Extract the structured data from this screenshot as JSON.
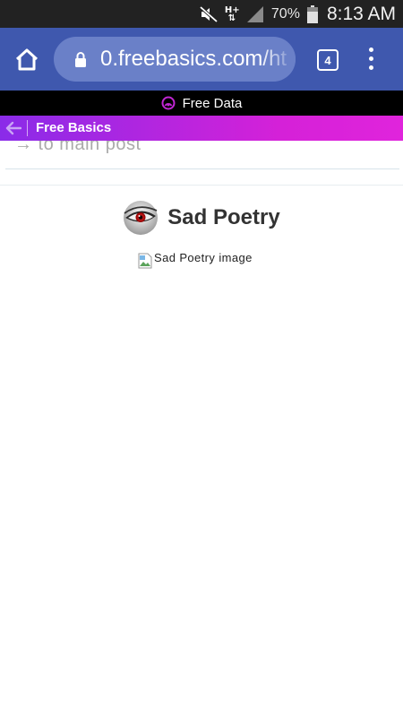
{
  "status_bar": {
    "network": "H+",
    "battery_percent": "70%",
    "time": "8:13 AM",
    "icons": [
      "mute-icon",
      "network-h-plus-icon",
      "signal-icon",
      "battery-icon"
    ]
  },
  "browser": {
    "url": "0.freebasics.com/ht",
    "tab_count": "4",
    "toolbar_color": "#3f58ae",
    "icons": [
      "home-icon",
      "lock-icon",
      "tabs-icon",
      "overflow-menu-icon"
    ]
  },
  "free_data_banner": {
    "label": "Free Data",
    "icon": "free-data-icon"
  },
  "free_basics_bar": {
    "title": "Free Basics",
    "icon": "back-arrow-icon",
    "colors": [
      "#8a2be8",
      "#e024dc"
    ]
  },
  "page": {
    "main_post_link": "→ to main post",
    "post_title": "Sad Poetry",
    "avatar_icon": "red-eye-avatar-icon",
    "image_alt": "Sad Poetry image"
  }
}
